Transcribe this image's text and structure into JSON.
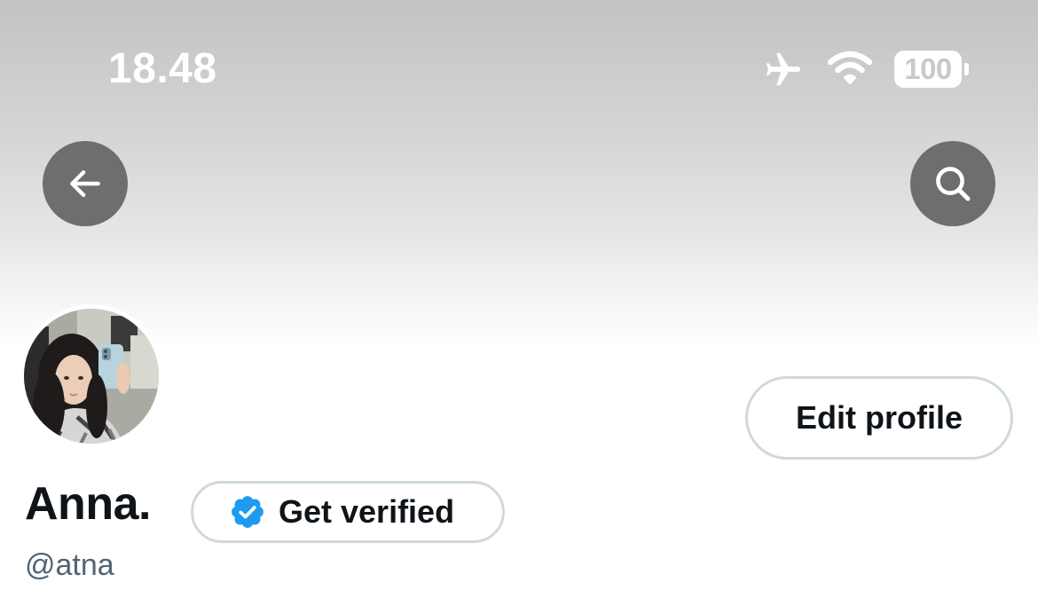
{
  "status_bar": {
    "time": "18.48",
    "battery_level": "100",
    "icons": [
      "airplane-mode-icon",
      "wifi-icon",
      "battery-icon"
    ]
  },
  "header": {
    "back_icon": "arrow-left-icon",
    "search_icon": "search-icon"
  },
  "profile": {
    "display_name": "Anna.",
    "handle": "@atna",
    "edit_profile_label": "Edit profile",
    "get_verified_label": "Get verified",
    "verified_badge_icon": "verified-badge-icon"
  },
  "colors": {
    "verified_blue": "#1d9bf0",
    "text_primary": "#0f1419",
    "text_secondary": "#536471",
    "button_border": "#cfd9de",
    "header_button_bg": "#6e6e6e"
  }
}
